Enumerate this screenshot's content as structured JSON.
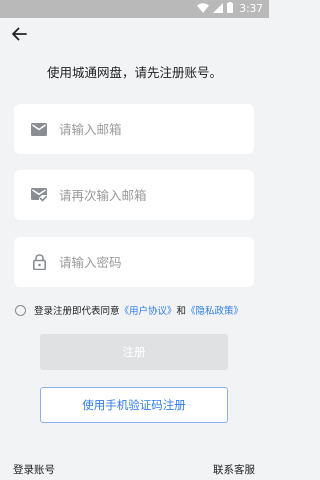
{
  "status_bar": {
    "time": "3:37",
    "icons": [
      "wifi-icon",
      "signal-icon",
      "battery-icon"
    ],
    "background": "#b9b9b9"
  },
  "nav": {
    "back_icon": "arrow-left-icon"
  },
  "headline": "使用城通网盘，请先注册账号。",
  "form": {
    "email": {
      "icon": "mail-icon",
      "placeholder": "请输入邮箱",
      "value": ""
    },
    "email_confirm": {
      "icon": "mail-check-icon",
      "placeholder": "请再次输入邮箱",
      "value": ""
    },
    "password": {
      "icon": "lock-icon",
      "placeholder": "请输入密码",
      "value": ""
    }
  },
  "agreement": {
    "checked": false,
    "prefix": "登录注册即代表同意",
    "terms_link": "《用户协议》",
    "conjunction": "和",
    "privacy_link": "《隐私政策》"
  },
  "buttons": {
    "register": "注册",
    "sms_register": "使用手机验证码注册"
  },
  "footer": {
    "login": "登录账号",
    "contact": "联系客服"
  },
  "colors": {
    "accent": "#2f7df0",
    "background": "#f2f3f5",
    "disabled_button": "#e0e1e3"
  }
}
